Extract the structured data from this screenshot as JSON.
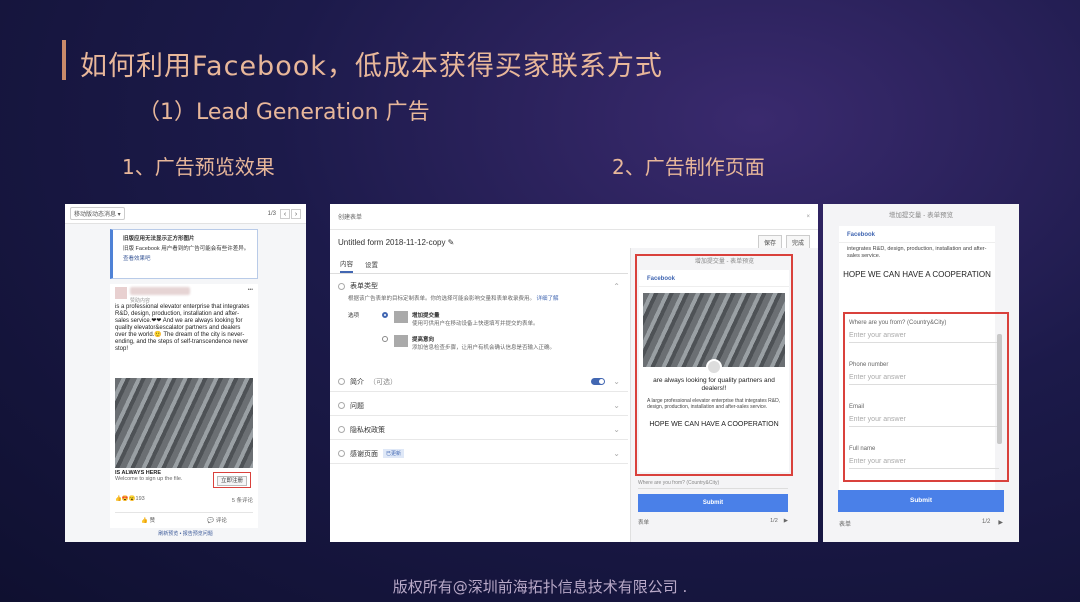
{
  "slide": {
    "title": "如何利用Facebook，低成本获得买家联系方式",
    "subtitle": "（1）Lead Generation 广告",
    "section1": "1、广告预览效果",
    "section2": "2、广告制作页面",
    "footer": "版权所有@深圳前海拓扑信息技术有限公司 ."
  },
  "preview_panel": {
    "dropdown": "移动版动态消息 ▾",
    "page_count": "1/3",
    "nav_prev": "‹",
    "nav_next": "›",
    "notice_title": "旧版应用无法显示正方形图片",
    "notice_body": "旧版 Facebook 用户看到的广告可能会有些许差异。",
    "notice_link": "查看效果吧",
    "author_sub": "赞助内容",
    "more": "•••",
    "post_text": "is a professional elevator enterprise that integrates R&D, design, production, installation and after-sales service.❤❤ And we are always looking for quality elevator&escalator partners and dealers over the world.🙂 The dream of the city is never-ending, and the steps of self-transcendence never stop!",
    "cta_headline": "IS ALWAYS HERE",
    "cta_sub": "Welcome to sign up the file.",
    "cta_button": "立即注册",
    "reaction_count": "193",
    "comment_count": "5 条评论",
    "like_label": "赞",
    "comment_label": "评论",
    "footer_link": "刷新预览 • 报告预览问题"
  },
  "editor_panel": {
    "window_title": "创建表单",
    "close": "×",
    "form_name": "Untitled form 2018-11-12-copy ✎",
    "save_btn": "保存",
    "done_btn": "完成",
    "tab_content": "内容",
    "tab_settings": "设置",
    "row_form_type": "表单类型",
    "type_desc": "根据该广告表单的目标定制表单。你的选择可能会影响交量和表单收录费用。",
    "type_link": "详细了解",
    "opt_label": "选项",
    "opt1_title": "增加提交量",
    "opt1_desc": "使用可供用户在移动设备上快速填写并提交的表单。",
    "opt2_title": "提高意向",
    "opt2_desc": "添加信息检查步骤，让用户有机会确认信息是否输入正确。",
    "row_intro": "简介",
    "row_intro_opt": "（可选）",
    "row_questions": "问题",
    "row_privacy": "隐私权政策",
    "row_thanks": "感谢页面",
    "row_thanks_badge": "已更新",
    "chevron": "⌄",
    "preview_title": "增加提交量 - 表单预览",
    "fb_tab": "Facebook",
    "prev_head": "are always looking for quality partners and dealers!!",
    "prev_desc": "A large professional elevator enterprise that integrates R&D, design, production, installation and after-sales service.",
    "prev_coop": "HOPE WE CAN HAVE A COOPERATION",
    "prev_q": "Where are you from? (Country&City)",
    "submit": "Submit",
    "foot_label": "表单",
    "foot_page": "1/2",
    "foot_next": "▶"
  },
  "form_preview_panel": {
    "title": "增加提交量 - 表单预览",
    "fb_tab": "Facebook",
    "desc": "integrates R&D, design, production, installation and after-sales service.",
    "coop": "HOPE WE CAN HAVE A COOPERATION",
    "fields": [
      {
        "label": "Where are you from? (Country&City)",
        "placeholder": "Enter your answer"
      },
      {
        "label": "Phone number",
        "placeholder": "Enter your answer"
      },
      {
        "label": "Email",
        "placeholder": "Enter your answer"
      },
      {
        "label": "Full name",
        "placeholder": "Enter your answer"
      }
    ],
    "submit": "Submit",
    "foot_label": "表单",
    "foot_page": "1/2",
    "foot_next": "▶"
  }
}
